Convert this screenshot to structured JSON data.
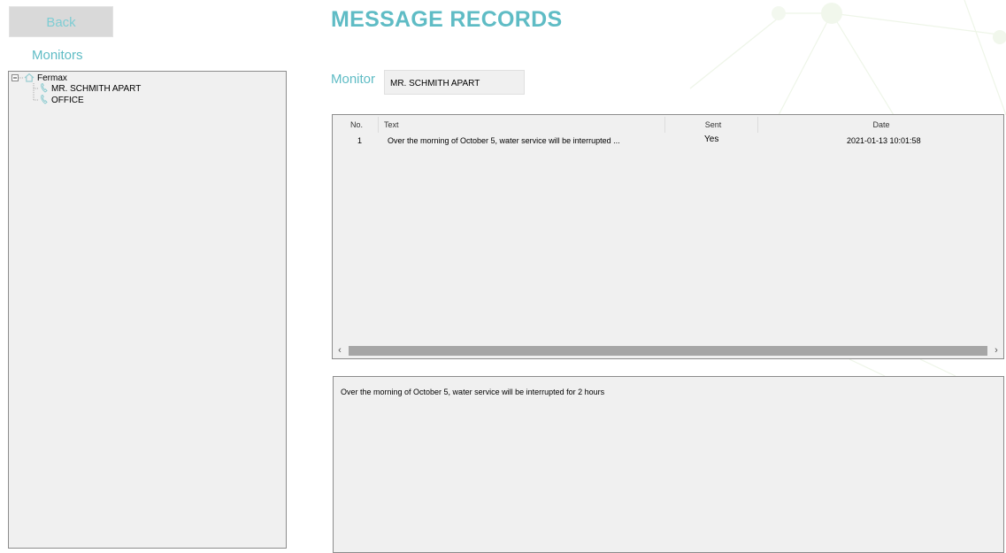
{
  "nav": {
    "back_label": "Back"
  },
  "sidebar": {
    "title": "Monitors",
    "tree": {
      "root": "Fermax",
      "children": [
        "MR. SCHMITH APART",
        "OFFICE"
      ]
    }
  },
  "main": {
    "title": "MESSAGE RECORDS",
    "monitor_label": "Monitor",
    "monitor_value": "MR. SCHMITH APART",
    "table": {
      "columns": [
        "No.",
        "Text",
        "Sent",
        "Date"
      ],
      "rows": [
        {
          "no": "1",
          "text": "Over the morning of October 5, water service will be interrupted ...",
          "sent": "Yes",
          "date": "2021-01-13 10:01:58"
        }
      ]
    },
    "detail_text": "Over the morning of October 5, water service will be interrupted for 2 hours"
  },
  "colors": {
    "accent": "#5fbcc5",
    "panel_bg": "#f0f0f0",
    "panel_border": "#8c8c8c"
  },
  "icons": {
    "tree_root": "home-icon",
    "tree_child": "phone-icon",
    "expander": "tree-collapse-icon"
  }
}
